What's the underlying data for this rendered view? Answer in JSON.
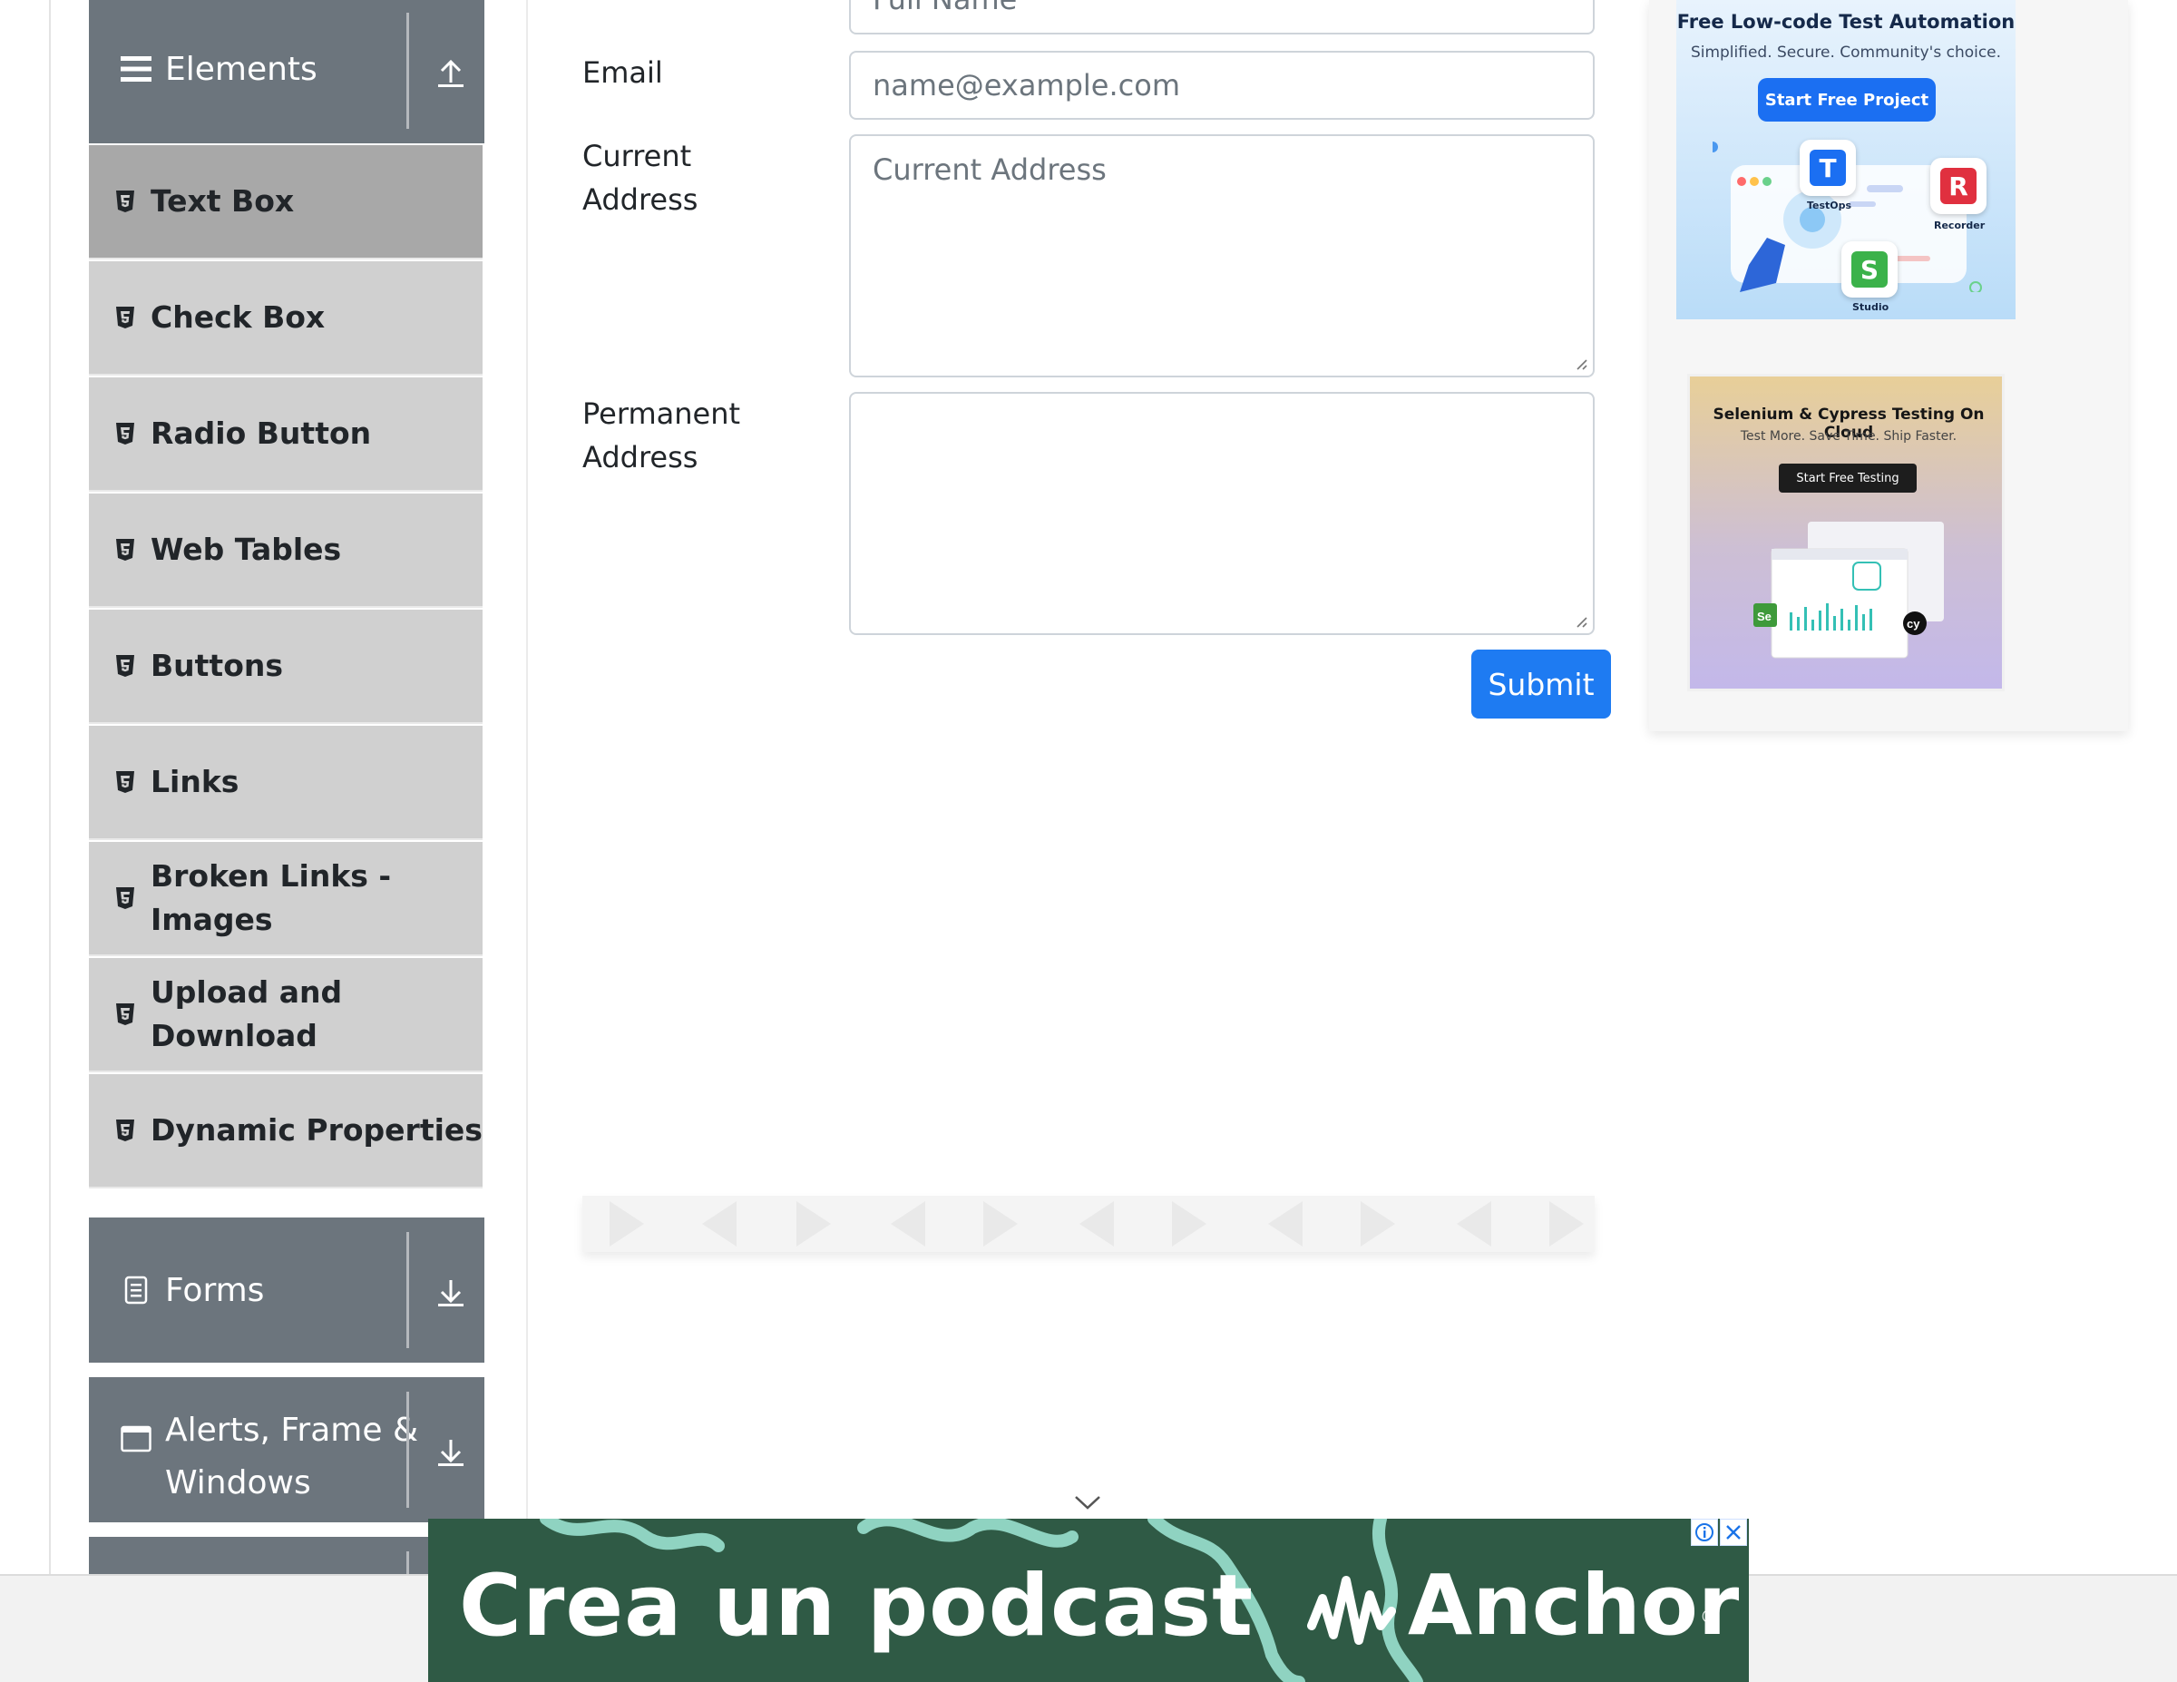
{
  "sidebar": {
    "elements_header": {
      "label": "Elements",
      "icon": "hamburger-icon",
      "toggle_icon": "upload-icon"
    },
    "items": [
      {
        "label": "Text Box",
        "icon": "html5-icon",
        "active": true
      },
      {
        "label": "Check Box",
        "icon": "html5-icon"
      },
      {
        "label": "Radio Button",
        "icon": "html5-icon"
      },
      {
        "label": "Web Tables",
        "icon": "html5-icon"
      },
      {
        "label": "Buttons",
        "icon": "html5-icon"
      },
      {
        "label": "Links",
        "icon": "html5-icon"
      },
      {
        "label": "Broken Links -\nImages",
        "icon": "html5-icon"
      },
      {
        "label": "Upload and Download",
        "icon": "html5-icon"
      },
      {
        "label": "Dynamic Properties",
        "icon": "html5-icon"
      }
    ],
    "forms_header": {
      "label": "Forms",
      "icon": "document-icon",
      "toggle_icon": "download-icon"
    },
    "alerts_header": {
      "label": "Alerts, Frame &\nWindows",
      "icon": "window-icon",
      "toggle_icon": "download-icon"
    }
  },
  "form": {
    "full_name": {
      "placeholder": "Full Name"
    },
    "email": {
      "label": "Email",
      "placeholder": "name@example.com"
    },
    "current_address": {
      "label": "Current\nAddress",
      "placeholder": "Current Address"
    },
    "permanent_address": {
      "label": "Permanent\nAddress",
      "placeholder": ""
    },
    "submit_label": "Submit",
    "submit_color": "#1e7bf2"
  },
  "ads": {
    "ad1": {
      "headline": "Free Low-code Test Automation",
      "subline": "Simplified. Secure. Community's choice.",
      "cta": "Start Free Project",
      "tiles": [
        {
          "letter": "T",
          "name": "TestOps",
          "color": "#1b6ff2"
        },
        {
          "letter": "R",
          "name": "Recorder",
          "color": "#e0303f"
        },
        {
          "letter": "S",
          "name": "Studio",
          "color": "#3bb24a"
        }
      ]
    },
    "ad2": {
      "headline": "Selenium & Cypress Testing On Cloud",
      "subline": "Test More. Save Time. Ship Faster.",
      "cta": "Start Free Testing",
      "badges": [
        "Se",
        "cy"
      ]
    }
  },
  "banner": {
    "tagline": "Crea un podcast",
    "brand": "Anchor",
    "registered_mark": "®",
    "background_color": "#2f5a45"
  },
  "theme": {
    "header_bg": "#6c757d",
    "item_bg": "#d0d0d0",
    "item_active_bg": "#a8a8a8"
  }
}
